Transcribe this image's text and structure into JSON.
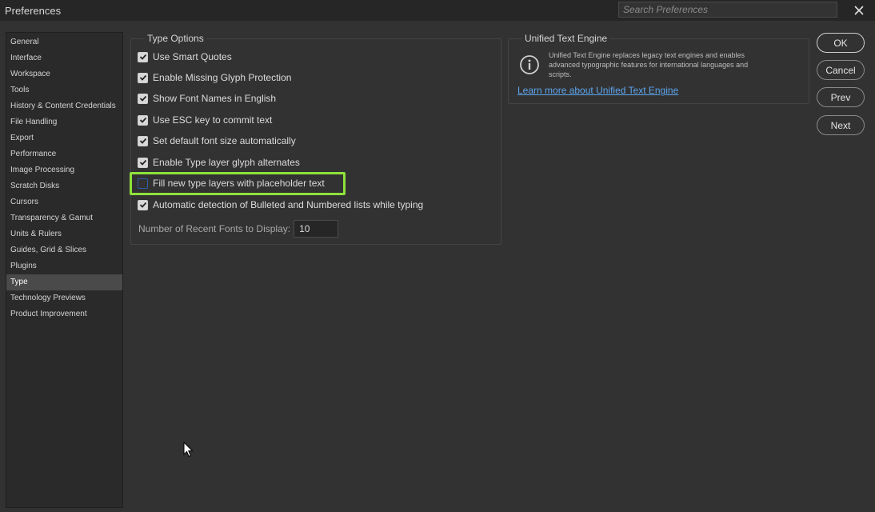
{
  "window": {
    "title": "Preferences",
    "search_placeholder": "Search Preferences"
  },
  "sidebar": {
    "items": [
      {
        "label": "General"
      },
      {
        "label": "Interface"
      },
      {
        "label": "Workspace"
      },
      {
        "label": "Tools"
      },
      {
        "label": "History & Content Credentials"
      },
      {
        "label": "File Handling"
      },
      {
        "label": "Export"
      },
      {
        "label": "Performance"
      },
      {
        "label": "Image Processing"
      },
      {
        "label": "Scratch Disks"
      },
      {
        "label": "Cursors"
      },
      {
        "label": "Transparency & Gamut"
      },
      {
        "label": "Units & Rulers"
      },
      {
        "label": "Guides, Grid & Slices"
      },
      {
        "label": "Plugins"
      },
      {
        "label": "Type",
        "selected": true
      },
      {
        "label": "Technology Previews"
      },
      {
        "label": "Product Improvement"
      }
    ]
  },
  "type_options": {
    "title": "Type Options",
    "options": [
      {
        "label": "Use Smart Quotes",
        "checked": true
      },
      {
        "label": "Enable Missing Glyph Protection",
        "checked": true
      },
      {
        "label": "Show Font Names in English",
        "checked": true
      },
      {
        "label": "Use ESC key to commit text",
        "checked": true
      },
      {
        "label": "Set default font size automatically",
        "checked": true
      },
      {
        "label": "Enable Type layer glyph alternates",
        "checked": true
      },
      {
        "label": "Fill new type layers with placeholder text",
        "checked": false,
        "highlighted": true
      },
      {
        "label": "Automatic detection of Bulleted and Numbered lists while typing",
        "checked": true
      }
    ],
    "recent_fonts_label": "Number of Recent Fonts to Display:",
    "recent_fonts_value": "10"
  },
  "unified_text_engine": {
    "title": "Unified Text Engine",
    "description": "Unified Text Engine replaces legacy text engines and enables advanced typographic features for international languages and scripts.",
    "link": "Learn more about Unified Text Engine"
  },
  "buttons": {
    "ok": "OK",
    "cancel": "Cancel",
    "prev": "Prev",
    "next": "Next"
  },
  "colors": {
    "highlight": "#8fe23a",
    "link": "#5da6ee",
    "background": "#323232"
  }
}
